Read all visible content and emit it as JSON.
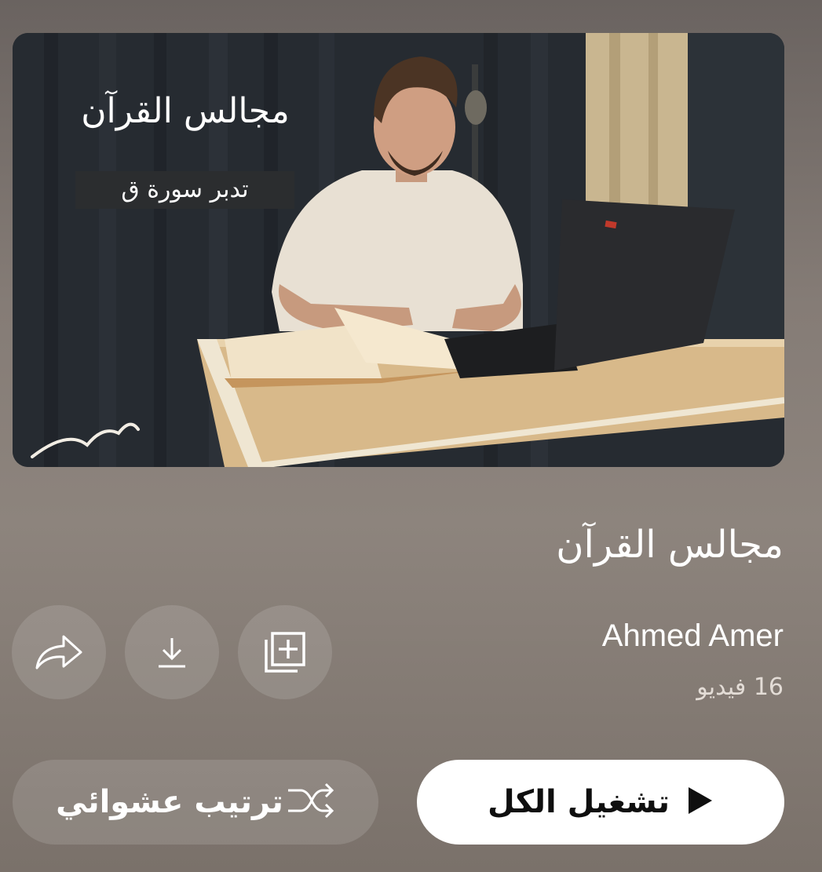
{
  "thumbnail": {
    "overlay_title": "مجالس القرآن",
    "overlay_subtitle": "تدبر سورة ق"
  },
  "playlist": {
    "title": "مجالس القرآن",
    "channel": "Ahmed Amer",
    "video_count": "16 فيديو"
  },
  "actions": {
    "save_icon": "playlist-add-icon",
    "download_icon": "download-icon",
    "share_icon": "share-icon"
  },
  "buttons": {
    "play_all_label": "تشغيل الكل",
    "play_icon": "play-icon",
    "shuffle_label": "ترتيب عشوائي",
    "shuffle_icon": "shuffle-icon"
  },
  "colors": {
    "background": "#857c76",
    "play_all_bg": "#ffffff",
    "text_primary": "#ffffff"
  }
}
